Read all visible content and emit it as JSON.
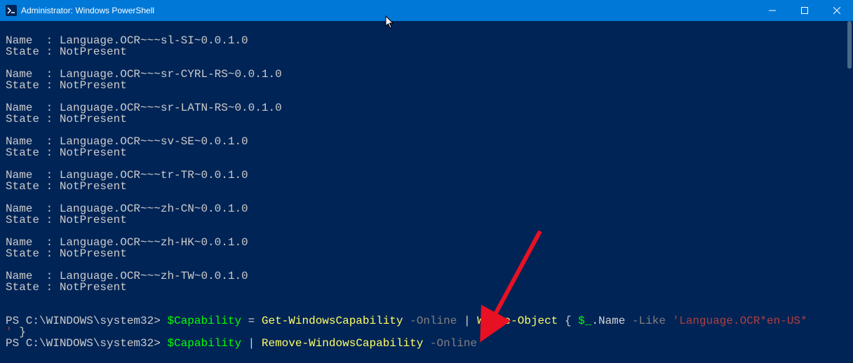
{
  "window": {
    "title": "Administrator: Windows PowerShell"
  },
  "labels": {
    "name": "Name  :",
    "state": "State :",
    "state_value": "NotPresent"
  },
  "capabilities": [
    "Language.OCR~~~sl-SI~0.0.1.0",
    "Language.OCR~~~sr-CYRL-RS~0.0.1.0",
    "Language.OCR~~~sr-LATN-RS~0.0.1.0",
    "Language.OCR~~~sv-SE~0.0.1.0",
    "Language.OCR~~~tr-TR~0.0.1.0",
    "Language.OCR~~~zh-CN~0.0.1.0",
    "Language.OCR~~~zh-HK~0.0.1.0",
    "Language.OCR~~~zh-TW~0.0.1.0"
  ],
  "prompt": {
    "path": "PS C:\\WINDOWS\\system32>",
    "line1": {
      "var": "$Capability",
      "assign": " = ",
      "cmd1": "Get-WindowsCapability",
      "param1": " -Online ",
      "pipe": "| ",
      "cmd2": "Where-Object",
      "brace_open": " { ",
      "var2": "$_",
      "dot": ".Name ",
      "param_like": "-Like ",
      "string": "'Language.OCR*en-US*",
      "string_cont": "'",
      "brace_close": " }"
    },
    "line2": {
      "var": "$Capability",
      "pipe": " | ",
      "cmd": "Remove-WindowsCapability",
      "param": " -Online"
    }
  }
}
